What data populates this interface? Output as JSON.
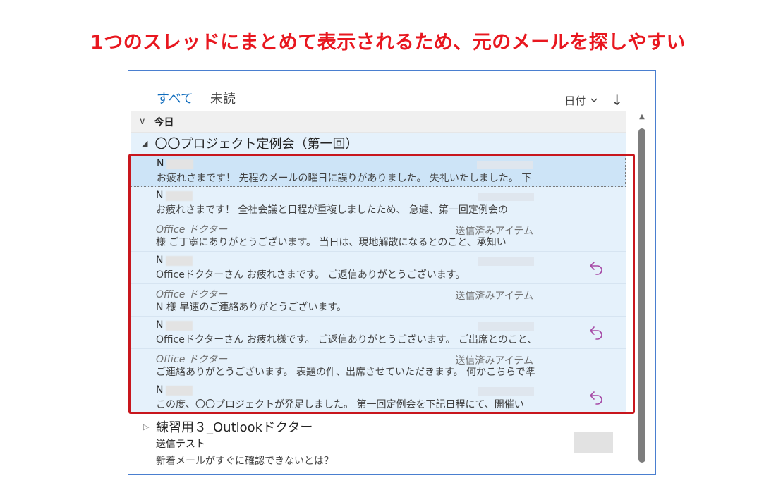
{
  "caption": "1つのスレッドにまとめて表示されるため、元のメールを探しやすい",
  "tabs": [
    {
      "label": "すべて",
      "active": true
    },
    {
      "label": "未読",
      "active": false
    }
  ],
  "sort": {
    "label": "日付",
    "chevron": "chevron-down-icon",
    "direction_icon": "arrow-down-icon"
  },
  "group": {
    "label": "今日"
  },
  "thread": {
    "title": "〇〇プロジェクト定例会（第一回）",
    "messages": [
      {
        "from": "N",
        "folder": "",
        "preview": "お疲れさまです！ 先程のメールの曜日に誤りがありました。 失礼いたしました。 下",
        "reply": false,
        "sent": false,
        "selected": true
      },
      {
        "from": "N",
        "folder": "",
        "preview": "お疲れさまです！ 全社会議と日程が重複しましたため、 急遽、第一回定例会の",
        "reply": false,
        "sent": false,
        "selected": false
      },
      {
        "from": "Office ドクター",
        "folder": "送信済みアイテム",
        "preview": "様 ご丁寧にありがとうございます。 当日は、現地解散になるとのこと、承知い",
        "reply": false,
        "sent": true,
        "selected": false
      },
      {
        "from": "N",
        "folder": "",
        "preview": "Officeドクターさん お疲れさまです。 ご返信ありがとうございます。",
        "reply": true,
        "sent": false,
        "selected": false
      },
      {
        "from": "Office ドクター",
        "folder": "送信済みアイテム",
        "preview": "N 様 早速のご連絡ありがとうございます。",
        "reply": false,
        "sent": true,
        "selected": false
      },
      {
        "from": "N",
        "folder": "",
        "preview": "Officeドクターさん お疲れ様です。 ご返信ありがとうございます。 ご出席とのこと、",
        "reply": true,
        "sent": false,
        "selected": false
      },
      {
        "from": "Office ドクター",
        "folder": "送信済みアイテム",
        "preview": "ご連絡ありがとうございます。 表題の件、出席させていただきます。 何かこちらで準",
        "reply": false,
        "sent": true,
        "selected": false
      },
      {
        "from": "N",
        "folder": "",
        "preview": "この度、〇〇プロジェクトが発足しました。 第一回定例会を下記日程にて、開催い",
        "reply": true,
        "sent": false,
        "selected": false
      }
    ]
  },
  "other_thread": {
    "title": "練習用３_Outlookドクター",
    "subject": "送信テスト",
    "preview": "新着メールがすぐに確認できないとは？"
  },
  "colors": {
    "accent": "#0f6cbd",
    "highlight": "#c8161d",
    "reply_icon": "#a64aa6",
    "caption": "#e8171f"
  }
}
